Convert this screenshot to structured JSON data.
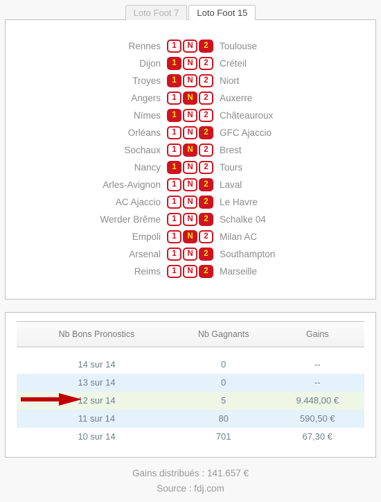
{
  "tabs": [
    {
      "label": "Loto Foot 7",
      "active": false
    },
    {
      "label": "Loto Foot 15",
      "active": true
    }
  ],
  "matches": [
    {
      "home": "Rennes",
      "away": "Toulouse",
      "cells": [
        "1",
        "N",
        "2"
      ],
      "selected": 2
    },
    {
      "home": "Dijon",
      "away": "Créteil",
      "cells": [
        "1",
        "N",
        "2"
      ],
      "selected": 0
    },
    {
      "home": "Troyes",
      "away": "Niort",
      "cells": [
        "1",
        "N",
        "2"
      ],
      "selected": 0
    },
    {
      "home": "Angers",
      "away": "Auxerre",
      "cells": [
        "1",
        "N",
        "2"
      ],
      "selected": 1
    },
    {
      "home": "Nïmes",
      "away": "Châteauroux",
      "cells": [
        "1",
        "N",
        "2"
      ],
      "selected": 0
    },
    {
      "home": "Orléans",
      "away": "GFC Ajaccio",
      "cells": [
        "1",
        "N",
        "2"
      ],
      "selected": 2
    },
    {
      "home": "Sochaux",
      "away": "Brest",
      "cells": [
        "1",
        "N",
        "2"
      ],
      "selected": 1
    },
    {
      "home": "Nancy",
      "away": "Tours",
      "cells": [
        "1",
        "N",
        "2"
      ],
      "selected": 0
    },
    {
      "home": "Arles-Avignon",
      "away": "Laval",
      "cells": [
        "1",
        "N",
        "2"
      ],
      "selected": 2
    },
    {
      "home": "AC Ajaccio",
      "away": "Le Havre",
      "cells": [
        "1",
        "N",
        "2"
      ],
      "selected": 2
    },
    {
      "home": "Werder Brême",
      "away": "Schalke 04",
      "cells": [
        "1",
        "N",
        "2"
      ],
      "selected": 2
    },
    {
      "home": "Empoli",
      "away": "Milan AC",
      "cells": [
        "1",
        "N",
        "2"
      ],
      "selected": 1
    },
    {
      "home": "Arsenal",
      "away": "Southampton",
      "cells": [
        "1",
        "N",
        "2"
      ],
      "selected": 2
    },
    {
      "home": "Reims",
      "away": "Marseille",
      "cells": [
        "1",
        "N",
        "2"
      ],
      "selected": 2
    }
  ],
  "results": {
    "headers": [
      "Nb Bons Pronostics",
      "Nb Gagnants",
      "Gains"
    ],
    "rows": [
      {
        "rank": "14 sur 14",
        "winners": "0",
        "gain": "--",
        "style": "plain"
      },
      {
        "rank": "13 sur 14",
        "winners": "0",
        "gain": "--",
        "style": "stripe"
      },
      {
        "rank": "12 sur 14",
        "winners": "5",
        "gain": "9.448,00 €",
        "style": "highlight"
      },
      {
        "rank": "11 sur 14",
        "winners": "80",
        "gain": "590,50 €",
        "style": "stripe"
      },
      {
        "rank": "10 sur 14",
        "winners": "701",
        "gain": "67,30 €",
        "style": "plain"
      }
    ]
  },
  "footer": {
    "gains_line": "Gains distribués : 141.657 €",
    "source_line": "Source : fdj.com"
  },
  "colors": {
    "brand_red": "#cf1320",
    "selected_text": "#ffe400",
    "stripe": "#e4f2fb",
    "highlight": "#eef6e6",
    "arrow": "#c00000",
    "page_bg": "#f8f8f8"
  }
}
